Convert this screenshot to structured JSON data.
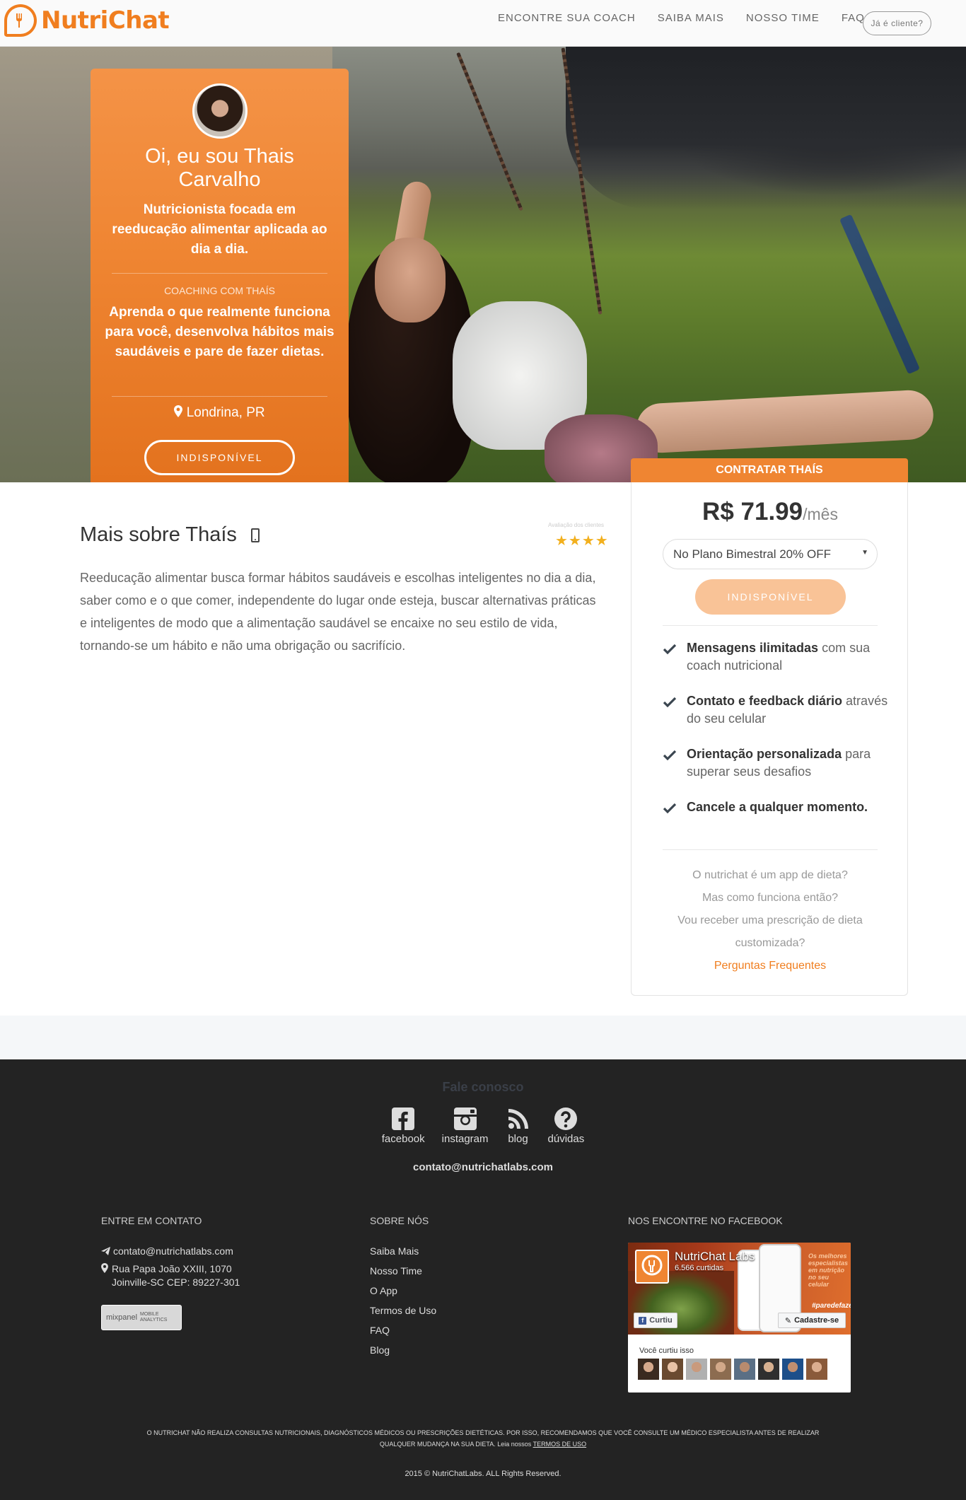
{
  "nav": {
    "brand": "NutriChat",
    "links": [
      "ENCONTRE SUA COACH",
      "SAIBA MAIS",
      "NOSSO TIME",
      "FAQ"
    ],
    "client_button": "Já é cliente?"
  },
  "profile": {
    "name": "Oi, eu sou Thais Carvalho",
    "tagline": "Nutricionista focada em reeducação alimentar aplicada ao dia a dia.",
    "coaching_label": "COACHING COM THAÍS",
    "coaching_desc": "Aprenda o que realmente funciona para você, desenvolva hábitos mais saudáveis e pare de fazer dietas.",
    "location": "Londrina, PR",
    "status_button": "INDISPONÍVEL"
  },
  "pricing": {
    "tab_label": "CONTRATAR THAÍS",
    "price": "R$ 71.99",
    "unit": "/mês",
    "plan_selected": "No Plano Bimestral 20% OFF",
    "button": "INDISPONÍVEL",
    "features": [
      {
        "bold": "Mensagens ilimitadas",
        "rest": " com sua coach nutricional"
      },
      {
        "bold": "Contato e feedback diário",
        "rest": " através do seu celular"
      },
      {
        "bold": "Orientação personalizada",
        "rest": " para superar seus desafios"
      },
      {
        "bold": "Cancele a qualquer momento.",
        "rest": ""
      }
    ],
    "faq_lines": [
      "O nutrichat é um app de dieta?",
      "Mas como funciona então?",
      "Vou receber uma prescrição de dieta",
      "customizada?"
    ],
    "faq_link": "Perguntas Frequentes"
  },
  "about": {
    "title": "Mais sobre Thaís",
    "rating_label": "Avaliação dos clientes",
    "stars": "★★★★",
    "rating": 4,
    "text": "Reeducação alimentar busca formar hábitos saudáveis e escolhas inteligentes no dia a dia, saber como e o que comer, independente do lugar onde esteja, buscar alternativas práticas e inteligentes de modo que a alimentação saudável se encaixe no seu estilo de vida, tornando-se um hábito e não uma obrigação ou sacrifício."
  },
  "footer": {
    "fale": "Fale conosco",
    "social": [
      {
        "label": "facebook",
        "icon": "facebook-icon"
      },
      {
        "label": "instagram",
        "icon": "instagram-icon"
      },
      {
        "label": "blog",
        "icon": "rss-icon"
      },
      {
        "label": "dúvidas",
        "icon": "question-icon"
      }
    ],
    "email": "contato@nutrichatlabs.com",
    "contact_title": "ENTRE EM CONTATO",
    "contact_email": "contato@nutrichatlabs.com",
    "address_line1": "Rua Papa João XXIII, 1070",
    "address_line2": "Joinville-SC CEP: 89227-301",
    "mixpanel": "mixpanel",
    "mixpanel_sub1": "MOBILE",
    "mixpanel_sub2": "ANALYTICS",
    "about_title": "SOBRE NÓS",
    "about_links": [
      "Saiba Mais",
      "Nosso Time",
      "O App",
      "Termos de Uso",
      "FAQ",
      "Blog"
    ],
    "fb_title": "NOS ENCONTRE NO FACEBOOK",
    "fb": {
      "page_name": "NutriChat Labs",
      "likes": "6.566 curtidas",
      "curtiu": "Curtiu",
      "cadastre": "Cadastre-se",
      "voce": "Você curtiu isso",
      "side_text": "Os melhores especialistas em nutrição no seu celular",
      "side_tag": "#paredefazerdieta"
    },
    "disclaimer": "O NUTRICHAT NÃO REALIZA CONSULTAS NUTRICIONAIS, DIAGNÓSTICOS MÉDICOS OU PRESCRIÇÕES DIETÉTICAS. POR ISSO, RECOMENDAMOS QUE VOCÊ CONSULTE UM MÉDICO ESPECIALISTA ANTES DE REALIZAR QUALQUER MUDANÇA NA SUA DIETA. Leia nossos",
    "disclaimer_link": "TERMOS DE USO",
    "copyright": "2015 © NutriChatLabs. ALL Rights Reserved."
  },
  "colors": {
    "accent": "#ef8532",
    "footer_bg": "#232323",
    "star": "#f2b01e"
  }
}
